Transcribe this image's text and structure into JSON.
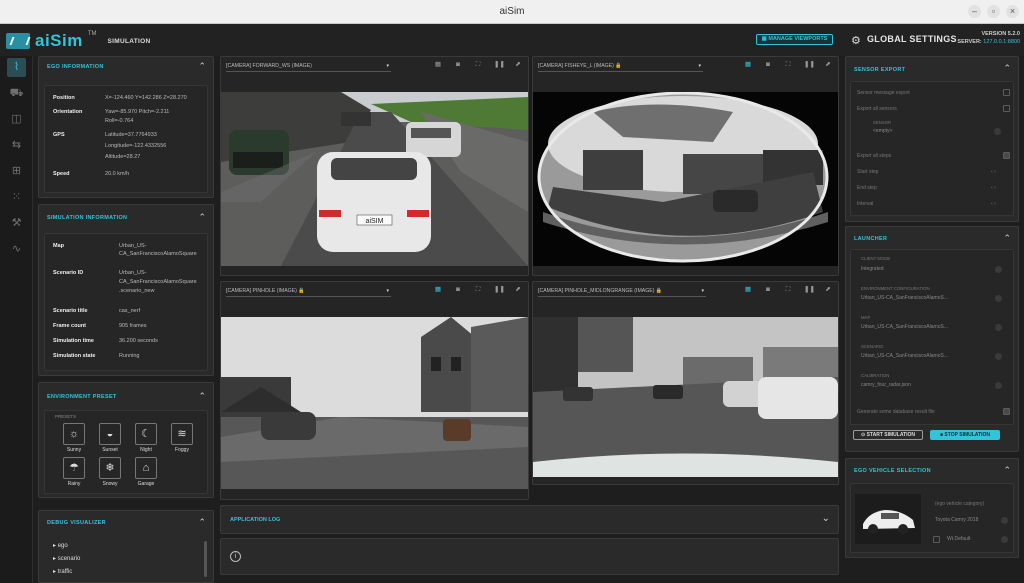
{
  "window": {
    "title": "aiSim"
  },
  "header": {
    "app_name": "aiSim",
    "trademark": "TM",
    "mode": "SIMULATION",
    "manage_viewports_label": "MANAGE VIEWPORTS",
    "global_settings_label": "GLOBAL SETTINGS",
    "version_line": "VERSION 5.2.0",
    "server_label": "SERVER:",
    "server_value": "127.0.0.1:8800"
  },
  "colors": {
    "accent": "#35c3d9",
    "panel": "#2a2a2a",
    "background": "#1e1e1e"
  },
  "sidebar_icons": [
    "viewports-icon",
    "vehicle-icon",
    "sensor-icon",
    "scenario-icon",
    "network-icon",
    "grid-icon",
    "chart-icon"
  ],
  "ego": {
    "title": "EGO INFORMATION",
    "rows": [
      {
        "k": "Position",
        "v": [
          "X=-124.460 Y=142.286 Z=28.270"
        ]
      },
      {
        "k": "Orientation",
        "v": [
          "Yaw=-85.970 Pitch=-2.211",
          "Roll=-0.764"
        ]
      },
      {
        "k": "GPS",
        "v": [
          "Latitude=37.7764933",
          "Longitude=-122.4332556",
          "Altitude=28.27"
        ]
      },
      {
        "k": "Speed",
        "v": [
          "20.0 km/h"
        ]
      }
    ]
  },
  "sim": {
    "title": "SIMULATION INFORMATION",
    "rows": [
      {
        "k": "Map",
        "v": [
          "Urban_US-",
          "CA_SanFranciscoAlamoSquare"
        ]
      },
      {
        "k": "Scenario ID",
        "v": [
          "Urban_US-",
          "CA_SanFranciscoAlamoSquare",
          ".scenario_new"
        ]
      },
      {
        "k": "Scenario title",
        "v": [
          "cas_nerf"
        ]
      },
      {
        "k": "Frame count",
        "v": [
          "905 frames"
        ]
      },
      {
        "k": "Simulation time",
        "v": [
          "36.200 seconds"
        ]
      },
      {
        "k": "Simulation state",
        "v": [
          "Running"
        ]
      }
    ]
  },
  "env": {
    "title": "ENVIRONMENT PRESET",
    "presets_label": "PRESETS",
    "items": [
      {
        "label": "Sunny",
        "icon": "sun-icon",
        "glyph": "☼"
      },
      {
        "label": "Sunset",
        "icon": "sunset-icon",
        "glyph": "◒"
      },
      {
        "label": "Night",
        "icon": "moon-icon",
        "glyph": "☾"
      },
      {
        "label": "Foggy",
        "icon": "fog-icon",
        "glyph": "≋"
      },
      {
        "label": "Rainy",
        "icon": "rain-icon",
        "glyph": "☂"
      },
      {
        "label": "Snowy",
        "icon": "snow-icon",
        "glyph": "❄"
      },
      {
        "label": "Garage",
        "icon": "garage-icon",
        "glyph": "⌂"
      }
    ]
  },
  "debug": {
    "title": "DEBUG VISUALIZER",
    "items": [
      "ego",
      "scenario",
      "traffic"
    ]
  },
  "viewports": [
    {
      "camera": "[CAMERA]  FORWARD_WS (IMAGE)"
    },
    {
      "camera": "[CAMERA]  FISHEYE_L (IMAGE) 🔒"
    },
    {
      "camera": "[CAMERA]  PINHOLE (IMAGE) 🔒"
    },
    {
      "camera": "[CAMERA]  PINHOLE_MIDLONGRANGE (IMAGE) 🔒"
    }
  ],
  "scene": {
    "car_plate": "aiSIM"
  },
  "log": {
    "title": "APPLICATION LOG",
    "info_icon": "i"
  },
  "sensor_export": {
    "title": "SENSOR EXPORT",
    "fields": [
      {
        "label": "Sensor message export",
        "type": "check"
      },
      {
        "label": "Export all sensors",
        "type": "check"
      },
      {
        "label": "SENSOR",
        "value": "<empty>",
        "type": "select"
      },
      {
        "label": "Export all steps",
        "type": "check"
      },
      {
        "label": "Start step",
        "type": "stepper"
      },
      {
        "label": "End step",
        "type": "stepper"
      },
      {
        "label": "Interval",
        "type": "stepper"
      }
    ]
  },
  "launcher": {
    "title": "LAUNCHER",
    "fields": [
      {
        "label": "CLIENT MODE",
        "value": "Integrated"
      },
      {
        "label": "ENVIRONMENT CONFIGURATION",
        "value": "Urban_US-CA_SanFranciscoAlamoS..."
      },
      {
        "label": "MAP",
        "value": "Urban_US-CA_SanFranciscoAlamoS..."
      },
      {
        "label": "SCENARIO",
        "value": "Urban_US-CA_SanFranciscoAlamoS..."
      },
      {
        "label": "CALIBRATION",
        "value": "camry_four_radar.json"
      }
    ],
    "generate_label": "Generate some database result file",
    "start_label": "START SIMULATION",
    "stop_label": "STOP SIMULATION"
  },
  "ego_vehicle": {
    "title": "EGO VEHICLE SELECTION",
    "category": "(ego vehicle category)",
    "vehicle": "Toyota Camry 2018",
    "option": "Wt.Default"
  }
}
